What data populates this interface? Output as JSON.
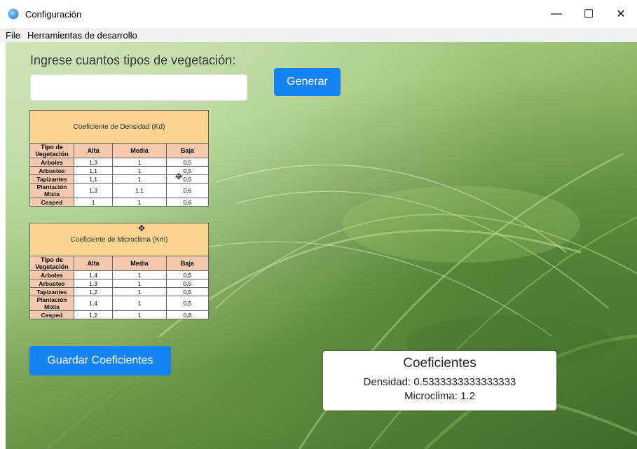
{
  "window": {
    "title": "Configuración",
    "minimize": "—",
    "maximize": "☐",
    "close": "✕"
  },
  "menu": [
    "File",
    "Herramientas de desarrollo"
  ],
  "form": {
    "prompt": "Ingrese cuantos tipos de vegetación:",
    "input_value": "",
    "input_placeholder": "",
    "generate_label": "Generar",
    "save_label": "Guardar Coeficientes"
  },
  "density_table": {
    "caption": "Coeficiente de Densidad (Kd)",
    "headers": [
      "Tipo de Vegetación",
      "Alta",
      "Media",
      "Baja"
    ],
    "rows": [
      [
        "Arboles",
        "1,3",
        "1",
        "0,5"
      ],
      [
        "Arbustos",
        "1,1",
        "1",
        "0,5"
      ],
      [
        "Tapizantes",
        "1,1",
        "1",
        "0,5"
      ],
      [
        "Plantación Mixta",
        "1,3",
        "1,1",
        "0,6"
      ],
      [
        "Cesped",
        "1",
        "1",
        "0,6"
      ]
    ]
  },
  "micro_table": {
    "caption": "Coeficiente de Microclima (Km)",
    "headers": [
      "Tipo de Vegetación",
      "Alta",
      "Media",
      "Baja"
    ],
    "rows": [
      [
        "Arboles",
        "1,4",
        "1",
        "0,5"
      ],
      [
        "Arbustos",
        "1,3",
        "1",
        "0,5"
      ],
      [
        "Tapizantes",
        "1,2",
        "1",
        "0,5"
      ],
      [
        "Plantación Mixta",
        "1,4",
        "1",
        "0,5"
      ],
      [
        "Cesped",
        "1,2",
        "1",
        "0,8"
      ]
    ]
  },
  "result": {
    "title": "Coeficientes",
    "density": "Densidad: 0.5333333333333333",
    "microclimate": "Microclima: 1.2"
  },
  "colors": {
    "accent": "#1683f5",
    "table_caption": "#fbd48f",
    "table_header": "#f5c9ae"
  }
}
